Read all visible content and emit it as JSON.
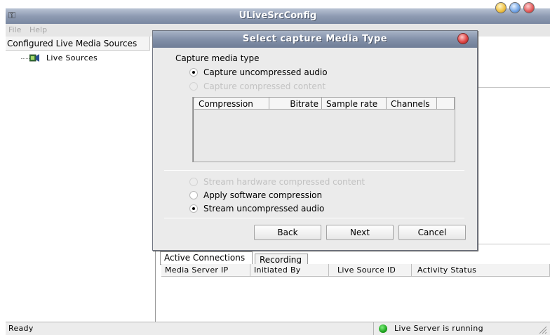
{
  "window": {
    "title": "ULiveSrcConfig",
    "app_icon": "app-icon"
  },
  "menu": {
    "file": "File",
    "help": "Help"
  },
  "left_panel": {
    "header": "Configured Live Media Sources",
    "tree_item": "Live Sources",
    "tree_icon": "live-sources-icon"
  },
  "dialog": {
    "title": "Select capture Media Type",
    "group_label": "Capture media type",
    "options_top": [
      {
        "label": "Capture uncompressed audio",
        "selected": true,
        "enabled": true
      },
      {
        "label": "Capture compressed content",
        "selected": false,
        "enabled": false
      }
    ],
    "list_columns": [
      "Compression",
      "Bitrate",
      "Sample rate",
      "Channels"
    ],
    "options_bottom": [
      {
        "label": "Stream hardware compressed content",
        "selected": false,
        "enabled": false
      },
      {
        "label": "Apply software compression",
        "selected": false,
        "enabled": true
      },
      {
        "label": "Stream uncompressed audio",
        "selected": true,
        "enabled": true
      }
    ],
    "buttons": {
      "back": "Back",
      "next": "Next",
      "cancel": "Cancel"
    }
  },
  "tabs": {
    "active_connections": "Active Connections",
    "recording": "Recording"
  },
  "connections_table": {
    "columns": [
      "Media Server IP",
      "Initiated By",
      "Live Source ID",
      "Activity Status"
    ]
  },
  "status": {
    "left": "Ready",
    "right": "Live Server is running",
    "indicator_color": "#1ea21e"
  }
}
